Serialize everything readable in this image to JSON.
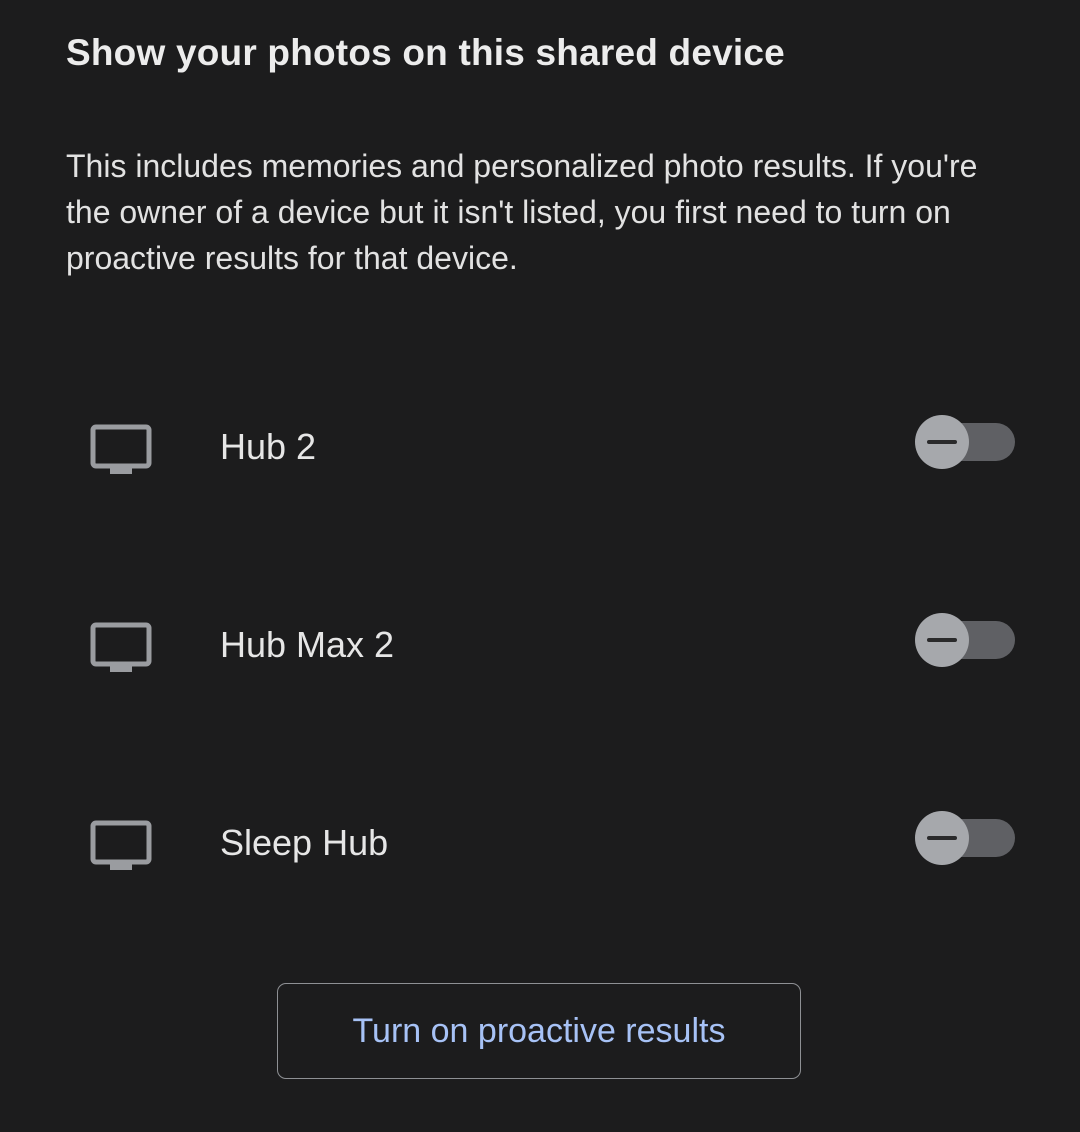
{
  "page": {
    "title": "Show your photos on this shared device",
    "description": "This includes memories and personalized photo results. If you're the owner of a device but it isn't listed, you first need to turn on proactive results for that device."
  },
  "devices": [
    {
      "label": "Hub 2",
      "icon": "display-icon",
      "toggle_state": "indeterminate"
    },
    {
      "label": "Hub Max 2",
      "icon": "display-icon",
      "toggle_state": "indeterminate"
    },
    {
      "label": "Sleep Hub",
      "icon": "display-icon",
      "toggle_state": "indeterminate"
    }
  ],
  "action": {
    "label": "Turn on proactive results"
  },
  "colors": {
    "background": "#1c1c1d",
    "accent_text": "#a7c2f6",
    "toggle_track": "#5f6064",
    "toggle_thumb": "#a6a8ac"
  }
}
